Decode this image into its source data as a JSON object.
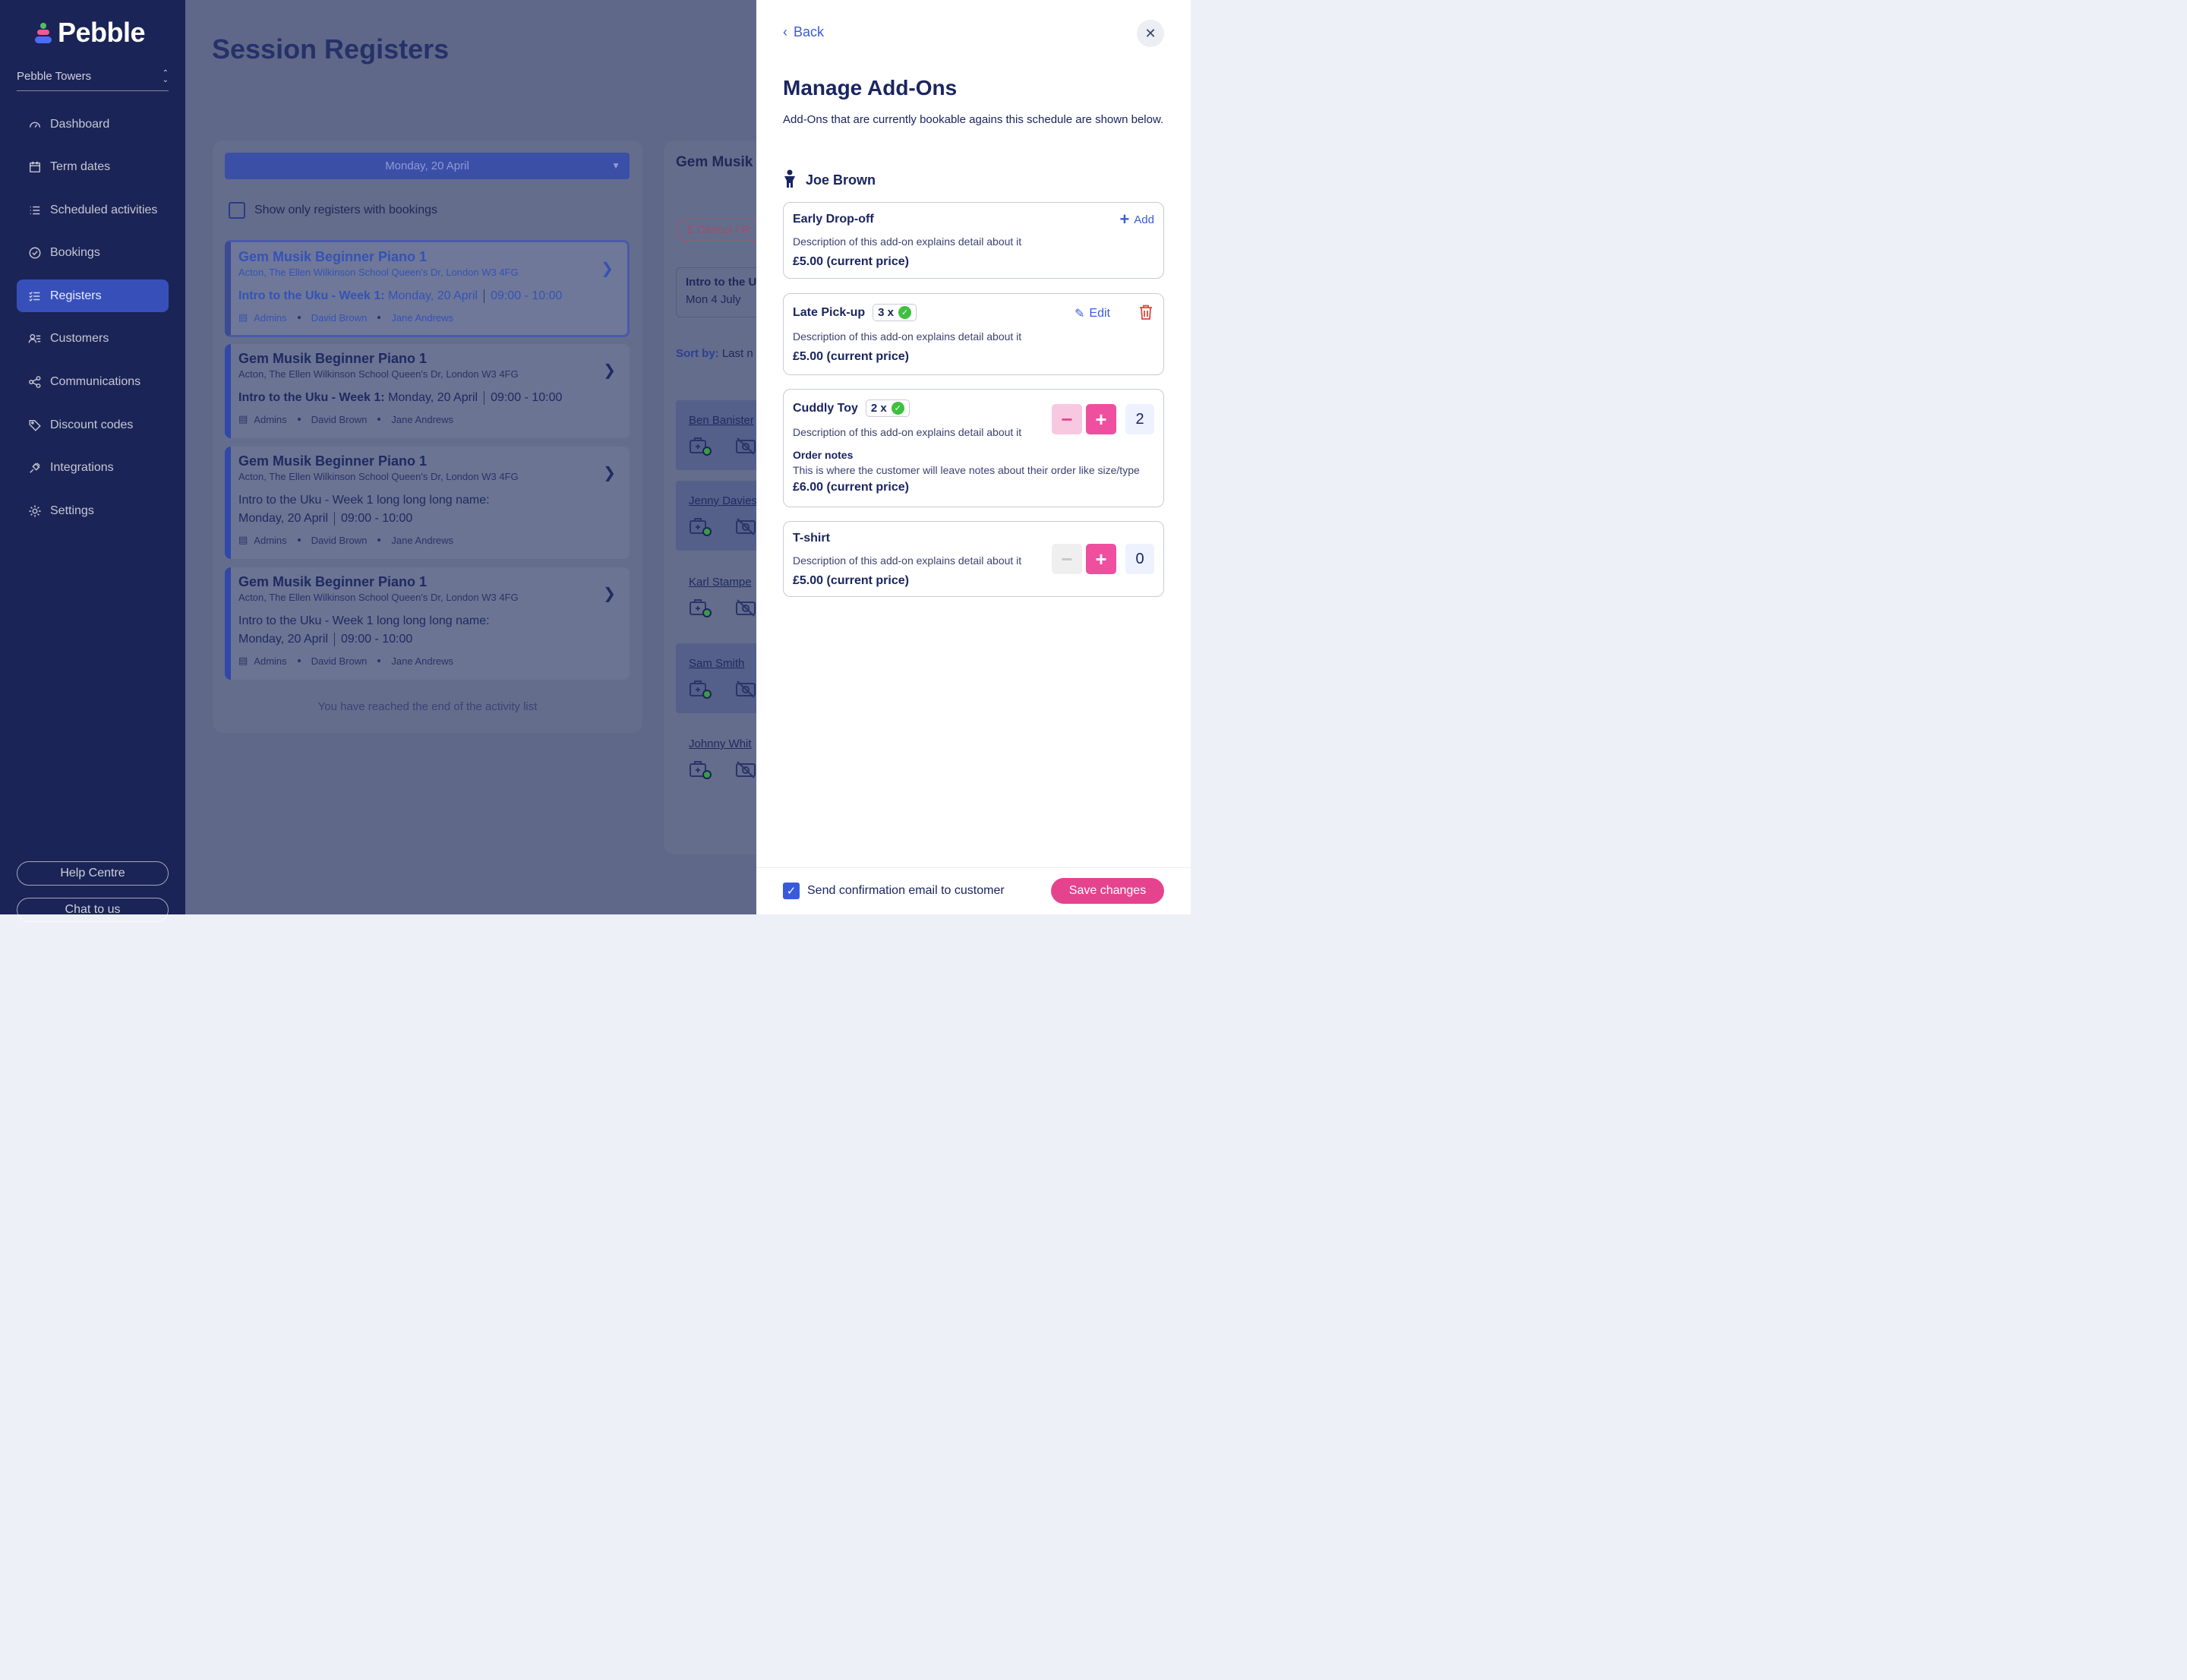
{
  "brand": {
    "name": "Pebble"
  },
  "sidebar": {
    "org": "Pebble Towers",
    "items": [
      {
        "label": "Dashboard",
        "icon": "dashboard-icon"
      },
      {
        "label": "Term dates",
        "icon": "calendar-icon"
      },
      {
        "label": "Scheduled activities",
        "icon": "list-icon"
      },
      {
        "label": "Bookings",
        "icon": "check-circle-icon"
      },
      {
        "label": "Registers",
        "icon": "checklist-icon",
        "active": true
      },
      {
        "label": "Customers",
        "icon": "customers-icon"
      },
      {
        "label": "Communications",
        "icon": "share-icon"
      },
      {
        "label": "Discount codes",
        "icon": "tag-icon"
      },
      {
        "label": "Integrations",
        "icon": "plug-icon"
      },
      {
        "label": "Settings",
        "icon": "gear-icon"
      }
    ],
    "help": "Help Centre",
    "chat": "Chat to us"
  },
  "main": {
    "title": "Session Registers",
    "date_select": "Monday, 20 April",
    "show_only_label": "Show only registers with bookings",
    "cards": [
      {
        "title": "Gem Musik Beginner Piano 1",
        "address": "Acton, The Ellen Wilkinson School Queen's Dr, London W3 4FG",
        "session": "Intro to the Uku - Week 1:",
        "date": "Monday, 20 April",
        "time": "09:00 - 10:00",
        "staff": [
          "Admins",
          "David Brown",
          "Jane Andrews"
        ]
      },
      {
        "title": "Gem Musik Beginner Piano 1",
        "address": "Acton, The Ellen Wilkinson School Queen's Dr, London W3 4FG",
        "session": "Intro to the Uku - Week 1:",
        "date": "Monday, 20 April",
        "time": "09:00 - 10:00",
        "staff": [
          "Admins",
          "David Brown",
          "Jane Andrews"
        ]
      },
      {
        "title": "Gem Musik Beginner Piano 1",
        "address": "Acton, The Ellen Wilkinson School Queen's Dr, London W3 4FG",
        "session": "Intro to the Uku - Week 1 long long long name:",
        "date": "Monday, 20 April",
        "time": "09:00 - 10:00",
        "staff": [
          "Admins",
          "David Brown",
          "Jane Andrews"
        ]
      },
      {
        "title": "Gem Musik Beginner Piano 1",
        "address": "Acton, The Ellen Wilkinson School Queen's Dr, London W3 4FG",
        "session": "Intro to the Uku - Week 1 long long long name:",
        "date": "Monday, 20 April",
        "time": "09:00 - 10:00",
        "staff": [
          "Admins",
          "David Brown",
          "Jane Andrews"
        ]
      }
    ],
    "list_end": "You have reached the end of the activity list",
    "right_panel": {
      "title": "Gem Musik",
      "pill": "£  Cancel / R",
      "box_title": "Intro to the U",
      "box_date": "Mon 4 July",
      "sort_label": "Sort by:",
      "sort_value": "Last n",
      "customers": [
        "Ben Banister",
        "Jenny Davies",
        "Karl Stampe",
        "Sam Smith",
        "Johnny Whit"
      ]
    }
  },
  "drawer": {
    "back": "Back",
    "title": "Manage Add-Ons",
    "description": "Add-Ons that are currently bookable agains this schedule are shown below.",
    "person": "Joe Brown",
    "addons": [
      {
        "name": "Early Drop-off",
        "description": "Description of this add-on explains detail about it",
        "price": "£5.00 (current price)",
        "action": "Add"
      },
      {
        "name": "Late Pick-up",
        "qty_badge": "3 x",
        "description": "Description of this add-on explains detail about it",
        "price": "£5.00 (current price)",
        "action": "Edit"
      },
      {
        "name": "Cuddly Toy",
        "qty_badge": "2 x",
        "description": "Description of this add-on explains detail about it",
        "notes_heading": "Order notes",
        "notes": "This is where the customer will leave notes about their order like size/type",
        "price": "£6.00 (current price)",
        "quantity": "2"
      },
      {
        "name": "T-shirt",
        "description": "Description of this add-on explains detail about it",
        "price": "£5.00 (current price)",
        "quantity": "0"
      }
    ],
    "confirm_label": "Send confirmation email to customer",
    "save": "Save changes"
  },
  "colors": {
    "sidebar": "#1b2456",
    "accent": "#3a5bd9",
    "pink": "#e6438e"
  }
}
